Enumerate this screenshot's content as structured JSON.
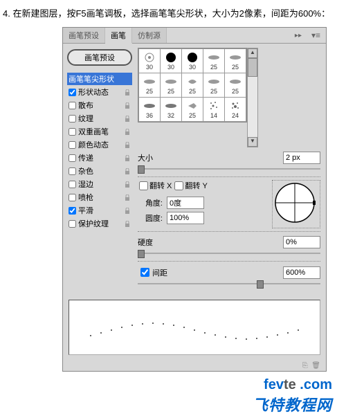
{
  "instruction": "4. 在新建图层，按F5画笔调板，选择画笔笔尖形状，大小为2像素，间距为600%：",
  "tabs": {
    "preset": "画笔预设",
    "brush": "画笔",
    "clone": "仿制源"
  },
  "preset_button": "画笔预设",
  "options": {
    "tip_shape": "画笔笔尖形状",
    "shape_dynamics": "形状动态",
    "scattering": "散布",
    "texture": "纹理",
    "dual_brush": "双重画笔",
    "color_dynamics": "颜色动态",
    "transfer": "传递",
    "noise": "杂色",
    "wet_edges": "湿边",
    "airbrush": "喷枪",
    "smoothing": "平滑",
    "protect_texture": "保护纹理"
  },
  "brush_sizes": [
    "30",
    "30",
    "30",
    "25",
    "25",
    "25",
    "25",
    "25",
    "25",
    "25",
    "36",
    "32",
    "25",
    "14",
    "24"
  ],
  "controls": {
    "size_label": "大小",
    "size_value": "2 px",
    "flip_x": "翻转 X",
    "flip_y": "翻转 Y",
    "angle_label": "角度:",
    "angle_value": "0度",
    "roundness_label": "圆度:",
    "roundness_value": "100%",
    "hardness_label": "硬度",
    "hardness_value": "0%",
    "spacing_label": "间距",
    "spacing_value": "600%"
  },
  "watermark": {
    "domain_pre": "fev",
    "domain_mid": "te",
    "domain_suf": " .com",
    "line2": "飞特教程网"
  }
}
